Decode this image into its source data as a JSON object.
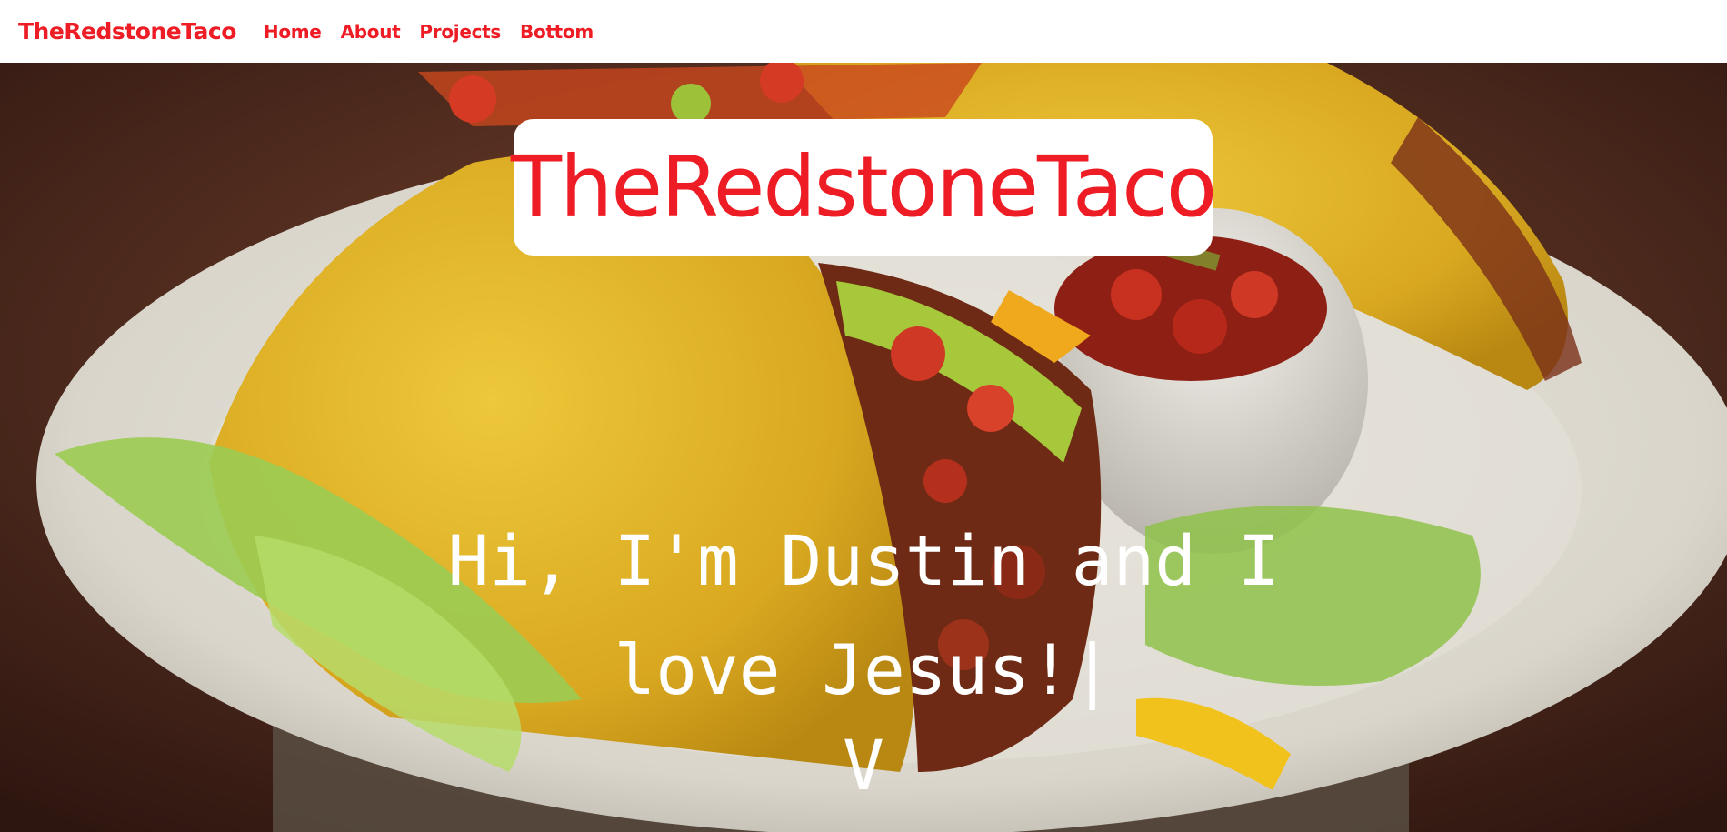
{
  "navbar": {
    "brand": "TheRedstoneTaco",
    "links": [
      "Home",
      "About",
      "Projects",
      "Bottom"
    ]
  },
  "hero": {
    "title": "TheRedstoneTaco",
    "tagline": "Hi, I'm Dustin and I love Jesus!",
    "cursor": "|",
    "scroll_arrow": "V",
    "background_image": "tacos-plate-photo"
  },
  "colors": {
    "brand_red": "#ee1c25",
    "taco_shell": "#e2b52c",
    "plate": "#dedbd2",
    "table": "#4a2a1e"
  }
}
